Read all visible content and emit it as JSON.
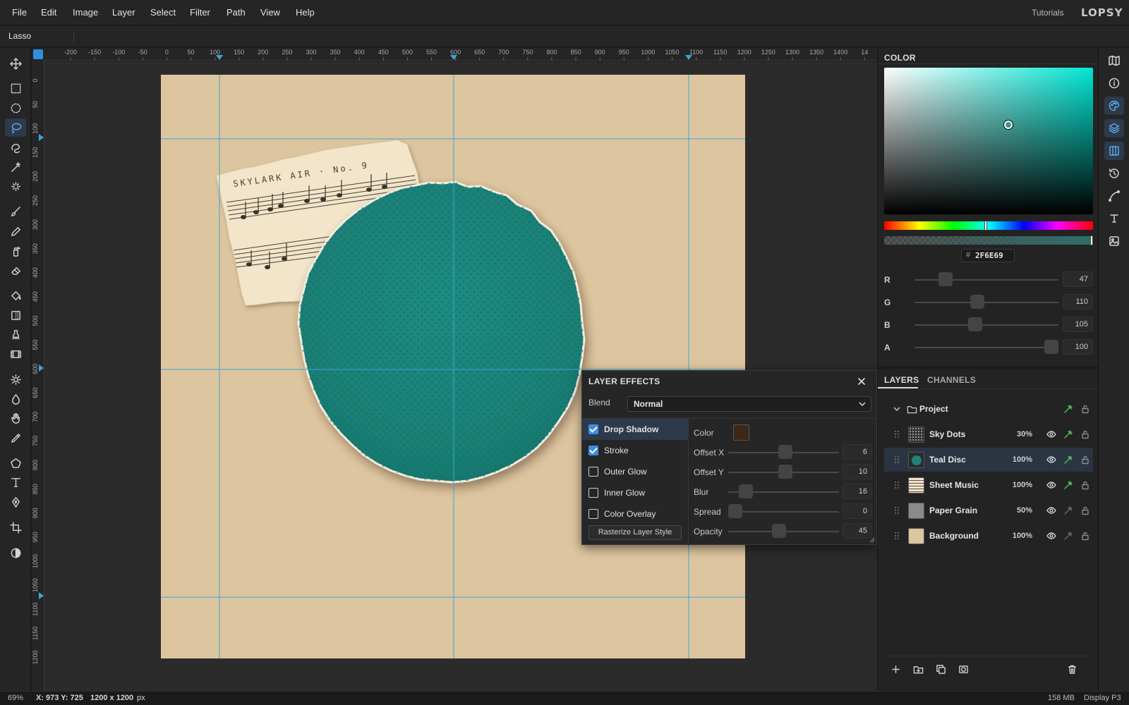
{
  "menubar": {
    "items": [
      "File",
      "Edit",
      "Image",
      "Layer",
      "Select",
      "Filter",
      "Path",
      "View",
      "Help"
    ],
    "tutorials_label": "Tutorials",
    "brand": "LOPSY"
  },
  "options": {
    "tool_name": "Lasso"
  },
  "toolbox": {
    "active_tool": "lasso",
    "tools": [
      "move",
      "rect-select",
      "ellipse-select",
      "lasso",
      "quick-select",
      "magic-wand",
      "spot-heal",
      "brush",
      "pencil",
      "clone",
      "eraser",
      "fill",
      "gradient",
      "stamp",
      "film",
      "dodge",
      "burn",
      "smudge",
      "eyedropper",
      "shape",
      "type",
      "pen",
      "crop",
      "contrast"
    ]
  },
  "rulers": {
    "h_labels": [
      "-200",
      "-150",
      "-100",
      "-50",
      "0",
      "50",
      "100",
      "150",
      "200",
      "250",
      "300",
      "350",
      "400",
      "450",
      "500",
      "550",
      "600",
      "650",
      "700",
      "750",
      "800",
      "850",
      "900",
      "950",
      "1000",
      "1050",
      "1100",
      "1150",
      "1200",
      "1250",
      "1300",
      "1350",
      "1400",
      "14"
    ],
    "v_labels": [
      "0",
      "50",
      "100",
      "150",
      "200",
      "250",
      "300",
      "350",
      "400",
      "450",
      "500",
      "550",
      "600",
      "650",
      "700",
      "750",
      "800",
      "850",
      "900",
      "950",
      "1000",
      "1050",
      "1100",
      "1150",
      "1200"
    ]
  },
  "canvas": {
    "background_color": "#DDC59F",
    "guide_color": "#3AA6D8",
    "sheet_music_title": "SKYLARK AIR · No. 9",
    "disc_color": "#1F8178"
  },
  "color_panel": {
    "title": "COLOR",
    "hex_prefix": "#",
    "hex": "2F6E69",
    "channels": [
      {
        "label": "R",
        "value": "47",
        "fraction": 0.184
      },
      {
        "label": "G",
        "value": "110",
        "fraction": 0.431
      },
      {
        "label": "B",
        "value": "105",
        "fraction": 0.412
      },
      {
        "label": "A",
        "value": "100",
        "fraction": 1.0
      }
    ],
    "hue_fraction": 0.487
  },
  "layer_effects": {
    "title": "LAYER EFFECTS",
    "blend_label": "Blend",
    "blend_value": "Normal",
    "effects": [
      {
        "label": "Drop Shadow",
        "checked": true,
        "selected": true
      },
      {
        "label": "Stroke",
        "checked": true,
        "selected": false
      },
      {
        "label": "Outer Glow",
        "checked": false,
        "selected": false
      },
      {
        "label": "Inner Glow",
        "checked": false,
        "selected": false
      },
      {
        "label": "Color Overlay",
        "checked": false,
        "selected": false
      }
    ],
    "rasterize_label": "Rasterize Layer Style",
    "color_label": "Color",
    "shadow_color": "#3E2714",
    "params": [
      {
        "label": "Offset X",
        "value": "6",
        "fraction": 0.52
      },
      {
        "label": "Offset Y",
        "value": "10",
        "fraction": 0.52
      },
      {
        "label": "Blur",
        "value": "16",
        "fraction": 0.11
      },
      {
        "label": "Spread",
        "value": "0",
        "fraction": 0.0
      },
      {
        "label": "Opacity",
        "value": "45",
        "fraction": 0.45
      }
    ]
  },
  "layers_panel": {
    "tab_layers": "LAYERS",
    "tab_channels": "CHANNELS",
    "group_name": "Project",
    "layers": [
      {
        "name": "Sky Dots",
        "opacity": "30%",
        "fx": true,
        "selected": false
      },
      {
        "name": "Teal Disc",
        "opacity": "100%",
        "fx": true,
        "selected": true
      },
      {
        "name": "Sheet Music",
        "opacity": "100%",
        "fx": true,
        "selected": false
      },
      {
        "name": "Paper Grain",
        "opacity": "50%",
        "fx": false,
        "selected": false
      },
      {
        "name": "Background",
        "opacity": "100%",
        "fx": false,
        "selected": false
      }
    ]
  },
  "status": {
    "zoom": "69%",
    "coords": "X: 973  Y: 725",
    "doc_size": "1200 x 1200",
    "doc_unit": "px",
    "memory": "158 MB",
    "color_profile": "Display P3"
  },
  "icons": {
    "accent": "#5AA7E8",
    "fx_active": "#4CC35A"
  }
}
